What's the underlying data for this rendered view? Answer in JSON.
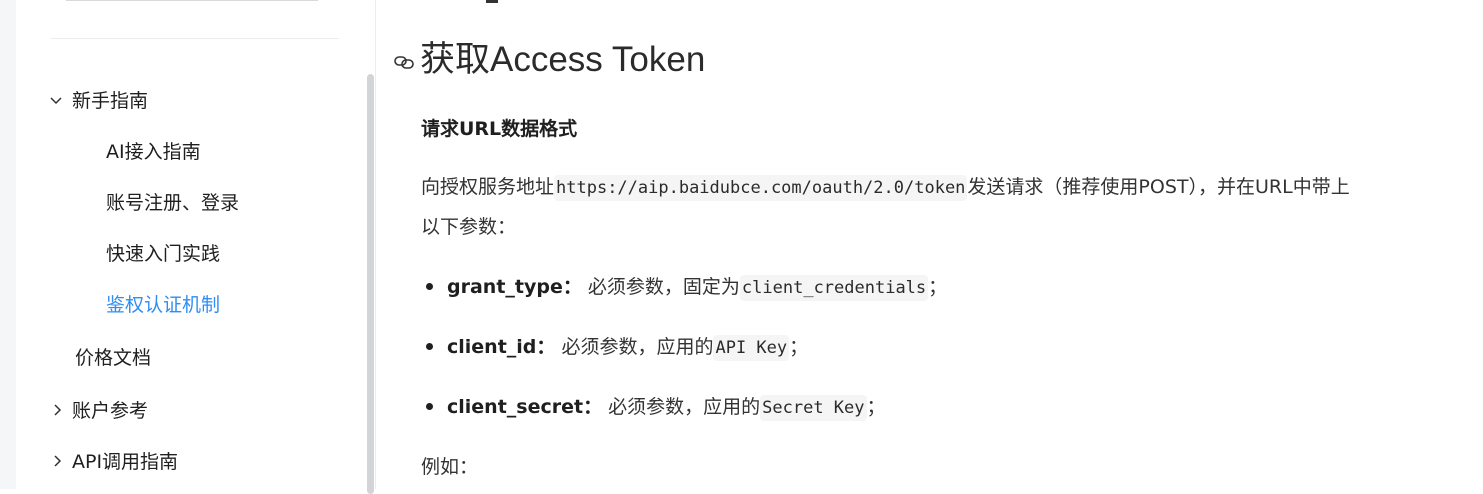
{
  "sidebar": {
    "items": [
      {
        "label": "新手指南"
      },
      {
        "label": "AI接入指南"
      },
      {
        "label": "账号注册、登录"
      },
      {
        "label": "快速入门实践"
      },
      {
        "label": "鉴权认证机制"
      },
      {
        "label": "价格文档"
      },
      {
        "label": "账户参考"
      },
      {
        "label": "API调用指南"
      }
    ],
    "active_color": "#2f8ef4"
  },
  "main": {
    "heading": "获取Access Token",
    "subheading": "请求URL数据格式",
    "intro": {
      "prefix": "向授权服务地址",
      "url": "https://aip.baidubce.com/oauth/2.0/token",
      "suffix": "发送请求（推荐使用POST），并在URL中带上",
      "line2": "以下参数："
    },
    "params": [
      {
        "name": "grant_type：",
        "desc": "必须参数，固定为",
        "code": "client_credentials",
        "end": "；"
      },
      {
        "name": "client_id：",
        "desc": "必须参数，应用的",
        "code": "API Key",
        "end": "；"
      },
      {
        "name": "client_secret：",
        "desc": "必须参数，应用的",
        "code": "Secret Key",
        "end": "；"
      }
    ],
    "example_label": "例如："
  }
}
